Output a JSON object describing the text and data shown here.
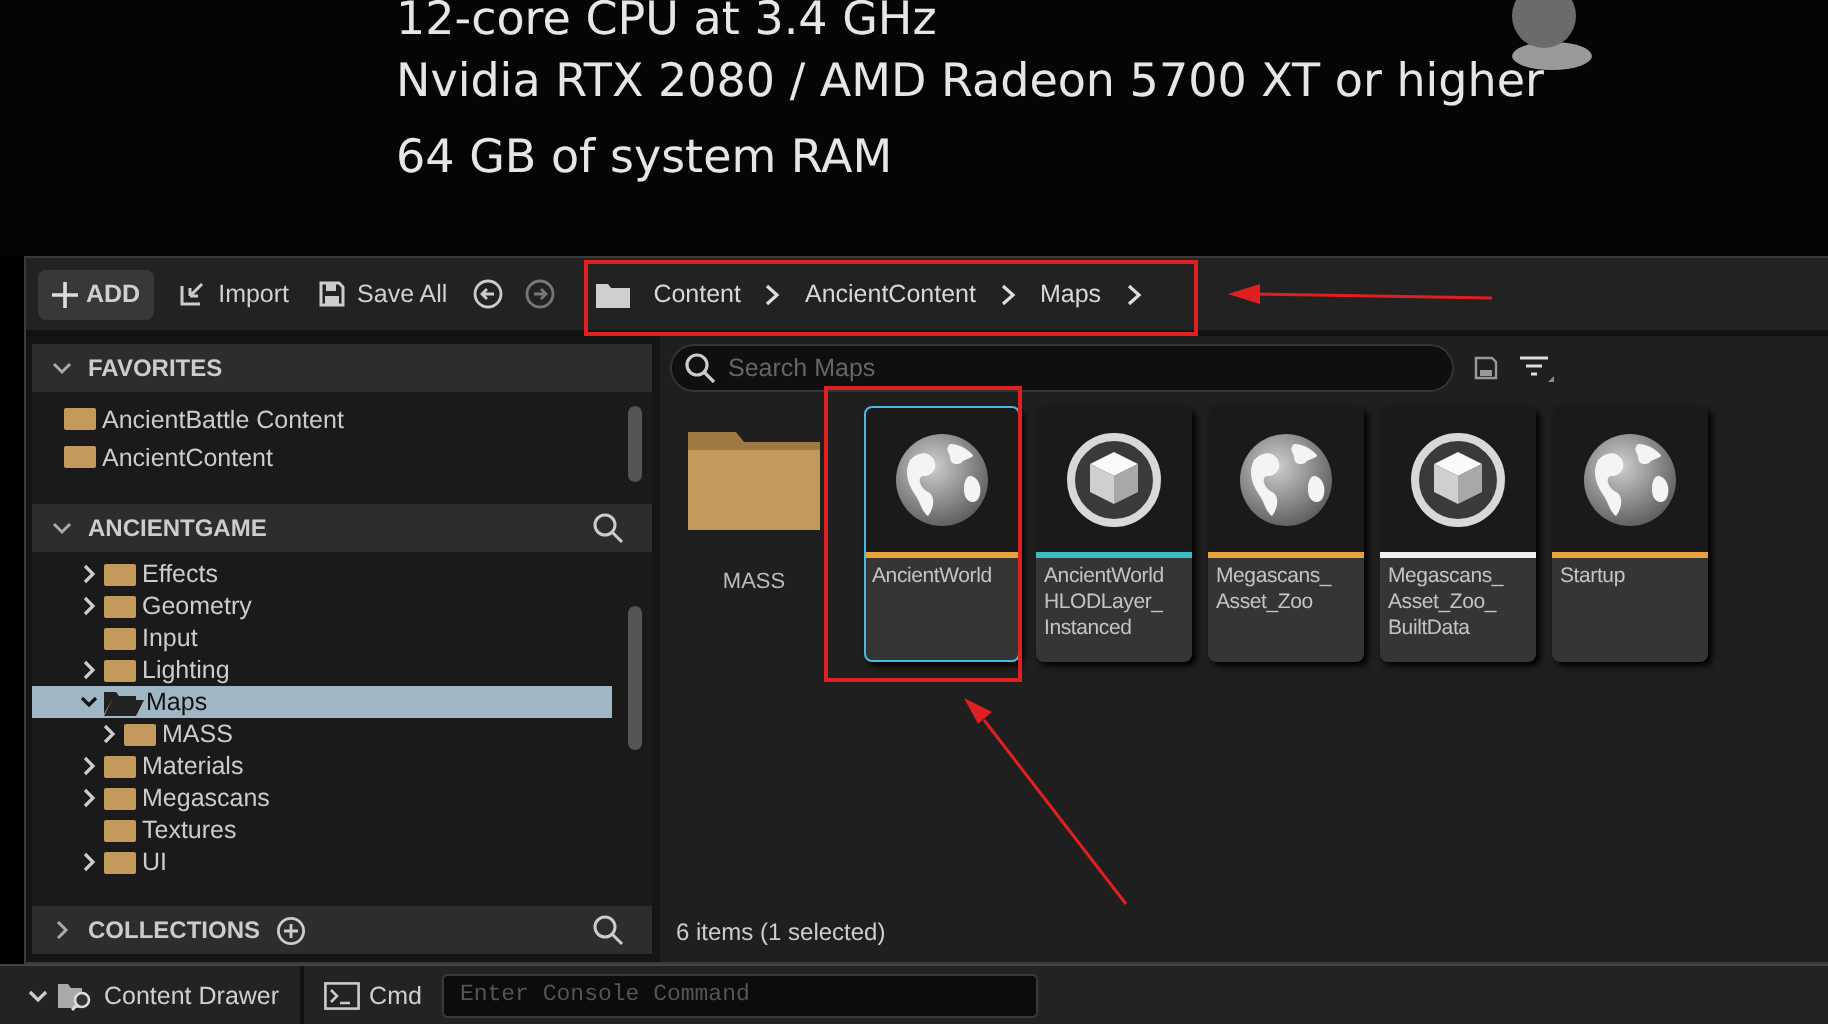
{
  "background_text": [
    "12-core CPU at 3.4 GHz",
    "Nvidia RTX 2080 / AMD Radeon 5700 XT or higher",
    "64 GB of system RAM"
  ],
  "toolbar": {
    "add": "ADD",
    "import": "Import",
    "save_all": "Save All",
    "breadcrumb": [
      "Content",
      "AncientContent",
      "Maps"
    ]
  },
  "favorites": {
    "title": "FAVORITES",
    "expanded": true,
    "items": [
      "AncientBattle Content",
      "AncientContent"
    ]
  },
  "project": {
    "title": "ANCIENTGAME",
    "expanded": true,
    "tree": [
      {
        "name": "Effects",
        "expandable": true,
        "expanded": false,
        "selected": false
      },
      {
        "name": "Geometry",
        "expandable": true,
        "expanded": false,
        "selected": false
      },
      {
        "name": "Input",
        "expandable": false,
        "selected": false
      },
      {
        "name": "Lighting",
        "expandable": true,
        "expanded": false,
        "selected": false
      },
      {
        "name": "Maps",
        "expandable": true,
        "expanded": true,
        "selected": true,
        "children": [
          {
            "name": "MASS",
            "expandable": true,
            "expanded": false,
            "selected": false
          }
        ]
      },
      {
        "name": "Materials",
        "expandable": true,
        "expanded": false,
        "selected": false
      },
      {
        "name": "Megascans",
        "expandable": true,
        "expanded": false,
        "selected": false
      },
      {
        "name": "Textures",
        "expandable": false,
        "selected": false
      },
      {
        "name": "UI",
        "expandable": true,
        "expanded": false,
        "selected": false
      }
    ]
  },
  "collections": {
    "title": "COLLECTIONS",
    "expanded": false
  },
  "search": {
    "placeholder": "Search Maps"
  },
  "assets": [
    {
      "kind": "folder",
      "name_lines": [
        "MASS"
      ],
      "selected": false
    },
    {
      "kind": "map",
      "name_lines": [
        "AncientWorld"
      ],
      "color": "#e8a23a",
      "selected": true
    },
    {
      "kind": "cube",
      "name_lines": [
        "AncientWorld",
        "HLODLayer_",
        "Instanced"
      ],
      "color": "#3bbcc4",
      "selected": false
    },
    {
      "kind": "map",
      "name_lines": [
        "Megascans_",
        "Asset_Zoo"
      ],
      "color": "#e8a23a",
      "selected": false
    },
    {
      "kind": "cube",
      "name_lines": [
        "Megascans_",
        "Asset_Zoo_",
        "BuiltData"
      ],
      "color": "#f2f2f2",
      "selected": false
    },
    {
      "kind": "map",
      "name_lines": [
        "Startup"
      ],
      "color": "#e8a23a",
      "selected": false
    }
  ],
  "status": "6 items (1 selected)",
  "bottom_bar": {
    "content_drawer": "Content Drawer",
    "cmd": "Cmd",
    "console_placeholder": "Enter Console Command"
  }
}
